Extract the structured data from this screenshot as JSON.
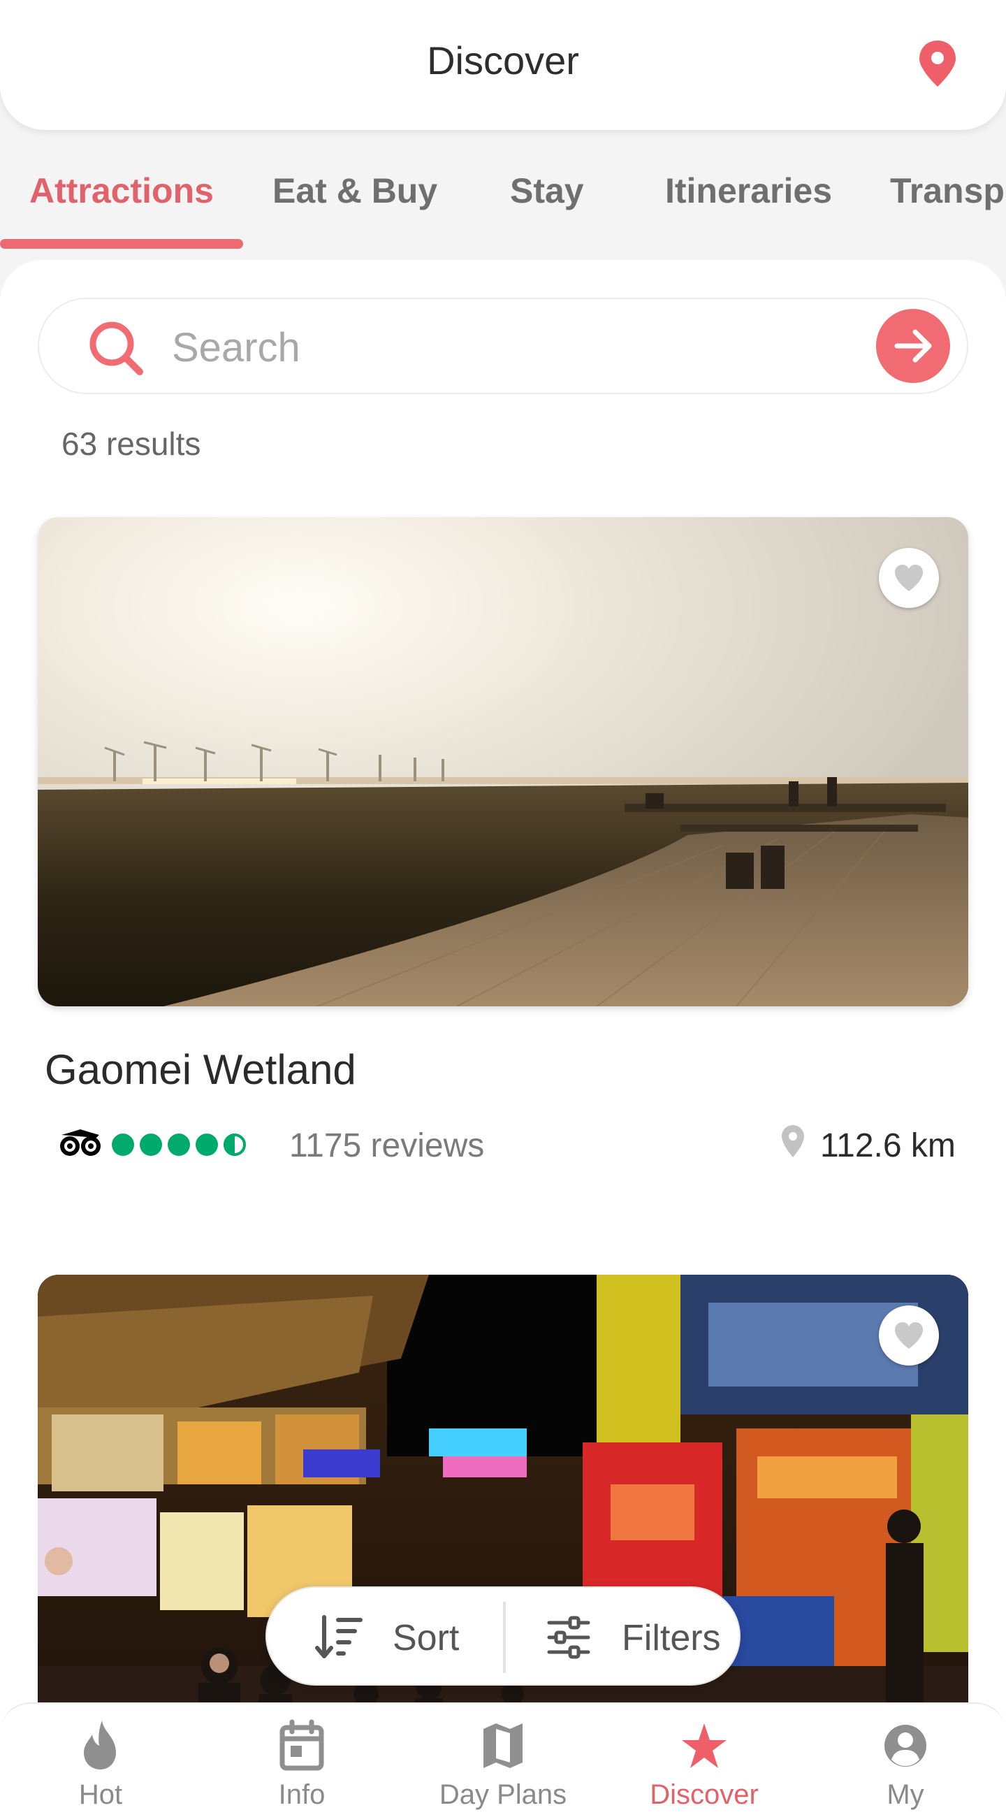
{
  "header": {
    "title": "Discover",
    "location_icon": "map-pin-icon"
  },
  "tabs": [
    {
      "label": "Attractions",
      "active": true
    },
    {
      "label": "Eat & Buy",
      "active": false
    },
    {
      "label": "Stay",
      "active": false
    },
    {
      "label": "Itineraries",
      "active": false
    },
    {
      "label": "Transport",
      "active": false
    }
  ],
  "search": {
    "placeholder": "Search",
    "value": ""
  },
  "results": {
    "count_text": "63 results"
  },
  "listings": [
    {
      "title": "Gaomei Wetland",
      "rating": 4.5,
      "reviews": "1175 reviews",
      "distance": "112.6 km",
      "favorited": false
    },
    {
      "title": "",
      "favorited": false
    }
  ],
  "floating_actions": {
    "sort_label": "Sort",
    "filters_label": "Filters"
  },
  "bottom_nav": [
    {
      "label": "Hot",
      "icon": "flame-icon",
      "active": false
    },
    {
      "label": "Info",
      "icon": "calendar-icon",
      "active": false
    },
    {
      "label": "Day Plans",
      "icon": "map-icon",
      "active": false
    },
    {
      "label": "Discover",
      "icon": "star-icon",
      "active": true
    },
    {
      "label": "My",
      "icon": "user-circle-icon",
      "active": false
    }
  ],
  "colors": {
    "accent": "#EC6B73",
    "rating_green": "#00AA6C"
  }
}
